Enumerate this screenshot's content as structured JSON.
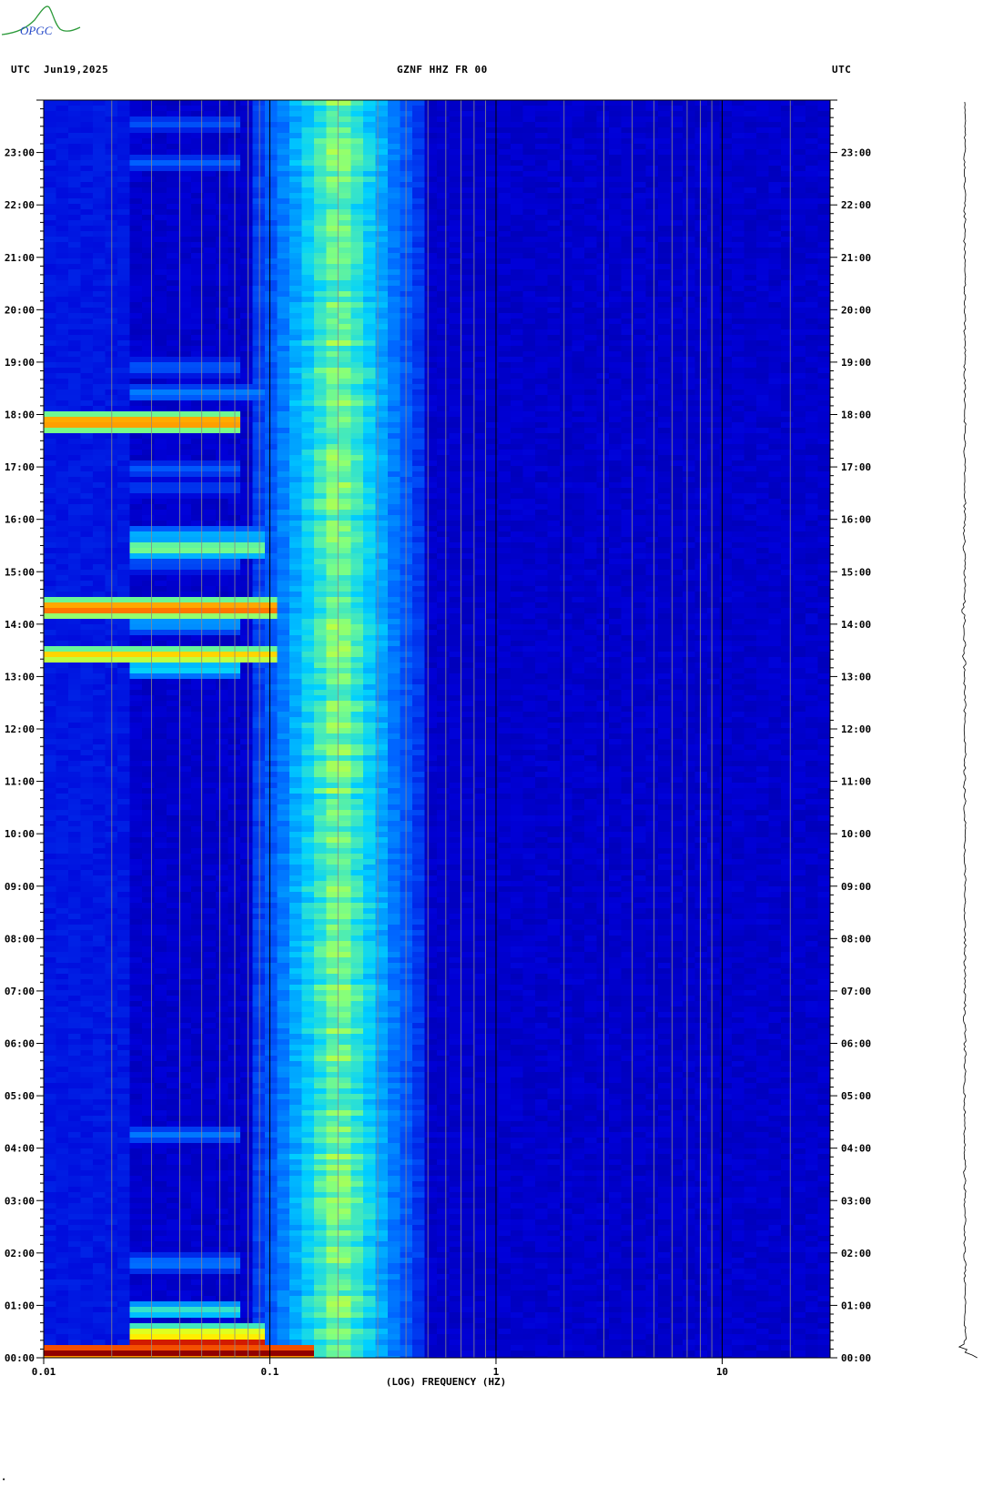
{
  "header": {
    "left_tz": "UTC",
    "date": "Jun19,2025",
    "station": "GZNF HHZ FR 00",
    "right_tz": "UTC"
  },
  "logo": {
    "text": "OPGC",
    "color": "#2c9a3a",
    "text_color": "#2448c8"
  },
  "chart_data": {
    "type": "heatmap",
    "title": "GZNF HHZ FR 00",
    "xlabel": "(LOG) FREQUENCY (HZ)",
    "x_scale": "log",
    "xlim": [
      0.01,
      30
    ],
    "x_tick_labels": [
      {
        "value": 0.01,
        "label": "0.01"
      },
      {
        "value": 0.1,
        "label": "0.1"
      },
      {
        "value": 1,
        "label": "1"
      },
      {
        "value": 10,
        "label": "10"
      }
    ],
    "minor_gridlines_hz": [
      0.02,
      0.03,
      0.04,
      0.05,
      0.06,
      0.07,
      0.08,
      0.09,
      0.2,
      0.3,
      0.4,
      0.5,
      0.6,
      0.7,
      0.8,
      0.9,
      2,
      3,
      4,
      5,
      6,
      7,
      8,
      9,
      20
    ],
    "y_tick_labels": [
      "00:00",
      "01:00",
      "02:00",
      "03:00",
      "04:00",
      "05:00",
      "06:00",
      "07:00",
      "08:00",
      "09:00",
      "10:00",
      "11:00",
      "12:00",
      "13:00",
      "14:00",
      "15:00",
      "16:00",
      "17:00",
      "18:00",
      "19:00",
      "20:00",
      "21:00",
      "22:00",
      "23:00"
    ],
    "ylim_hours": [
      0,
      24
    ],
    "colormap": [
      "#00008a",
      "#0000d8",
      "#0060ff",
      "#00d0ff",
      "#80ff80",
      "#ffff00",
      "#ff6000",
      "#c00000",
      "#800000"
    ],
    "background_level": 0.08,
    "microseism_band_hz": [
      0.12,
      0.4
    ],
    "microseism_peak_hz": 0.2,
    "events": [
      {
        "hour": 0.1,
        "f_min": 0.01,
        "f_max": 0.15,
        "level": 1.0
      },
      {
        "hour": 0.3,
        "f_min": 0.025,
        "f_max": 0.1,
        "level": 0.85
      },
      {
        "hour": 0.5,
        "f_min": 0.025,
        "f_max": 0.1,
        "level": 0.6
      },
      {
        "hour": 0.9,
        "f_min": 0.025,
        "f_max": 0.075,
        "level": 0.45
      },
      {
        "hour": 1.8,
        "f_min": 0.025,
        "f_max": 0.075,
        "level": 0.3
      },
      {
        "hour": 4.25,
        "f_min": 0.025,
        "f_max": 0.075,
        "level": 0.28
      },
      {
        "hour": 13.4,
        "f_min": 0.01,
        "f_max": 0.11,
        "level": 0.7
      },
      {
        "hour": 13.15,
        "f_min": 0.025,
        "f_max": 0.075,
        "level": 0.42
      },
      {
        "hour": 14.3,
        "f_min": 0.01,
        "f_max": 0.11,
        "level": 0.82
      },
      {
        "hour": 14.0,
        "f_min": 0.025,
        "f_max": 0.075,
        "level": 0.35
      },
      {
        "hour": 15.45,
        "f_min": 0.025,
        "f_max": 0.1,
        "level": 0.55
      },
      {
        "hour": 15.7,
        "f_min": 0.025,
        "f_max": 0.1,
        "level": 0.35
      },
      {
        "hour": 15.15,
        "f_min": 0.025,
        "f_max": 0.075,
        "level": 0.25
      },
      {
        "hour": 17.85,
        "f_min": 0.01,
        "f_max": 0.075,
        "level": 0.8
      },
      {
        "hour": 18.4,
        "f_min": 0.025,
        "f_max": 0.1,
        "level": 0.3
      },
      {
        "hour": 18.9,
        "f_min": 0.025,
        "f_max": 0.075,
        "level": 0.26
      },
      {
        "hour": 16.95,
        "f_min": 0.025,
        "f_max": 0.075,
        "level": 0.25
      },
      {
        "hour": 16.6,
        "f_min": 0.025,
        "f_max": 0.075,
        "level": 0.22
      },
      {
        "hour": 22.8,
        "f_min": 0.025,
        "f_max": 0.075,
        "level": 0.25
      },
      {
        "hour": 23.55,
        "f_min": 0.025,
        "f_max": 0.075,
        "level": 0.24
      }
    ]
  }
}
